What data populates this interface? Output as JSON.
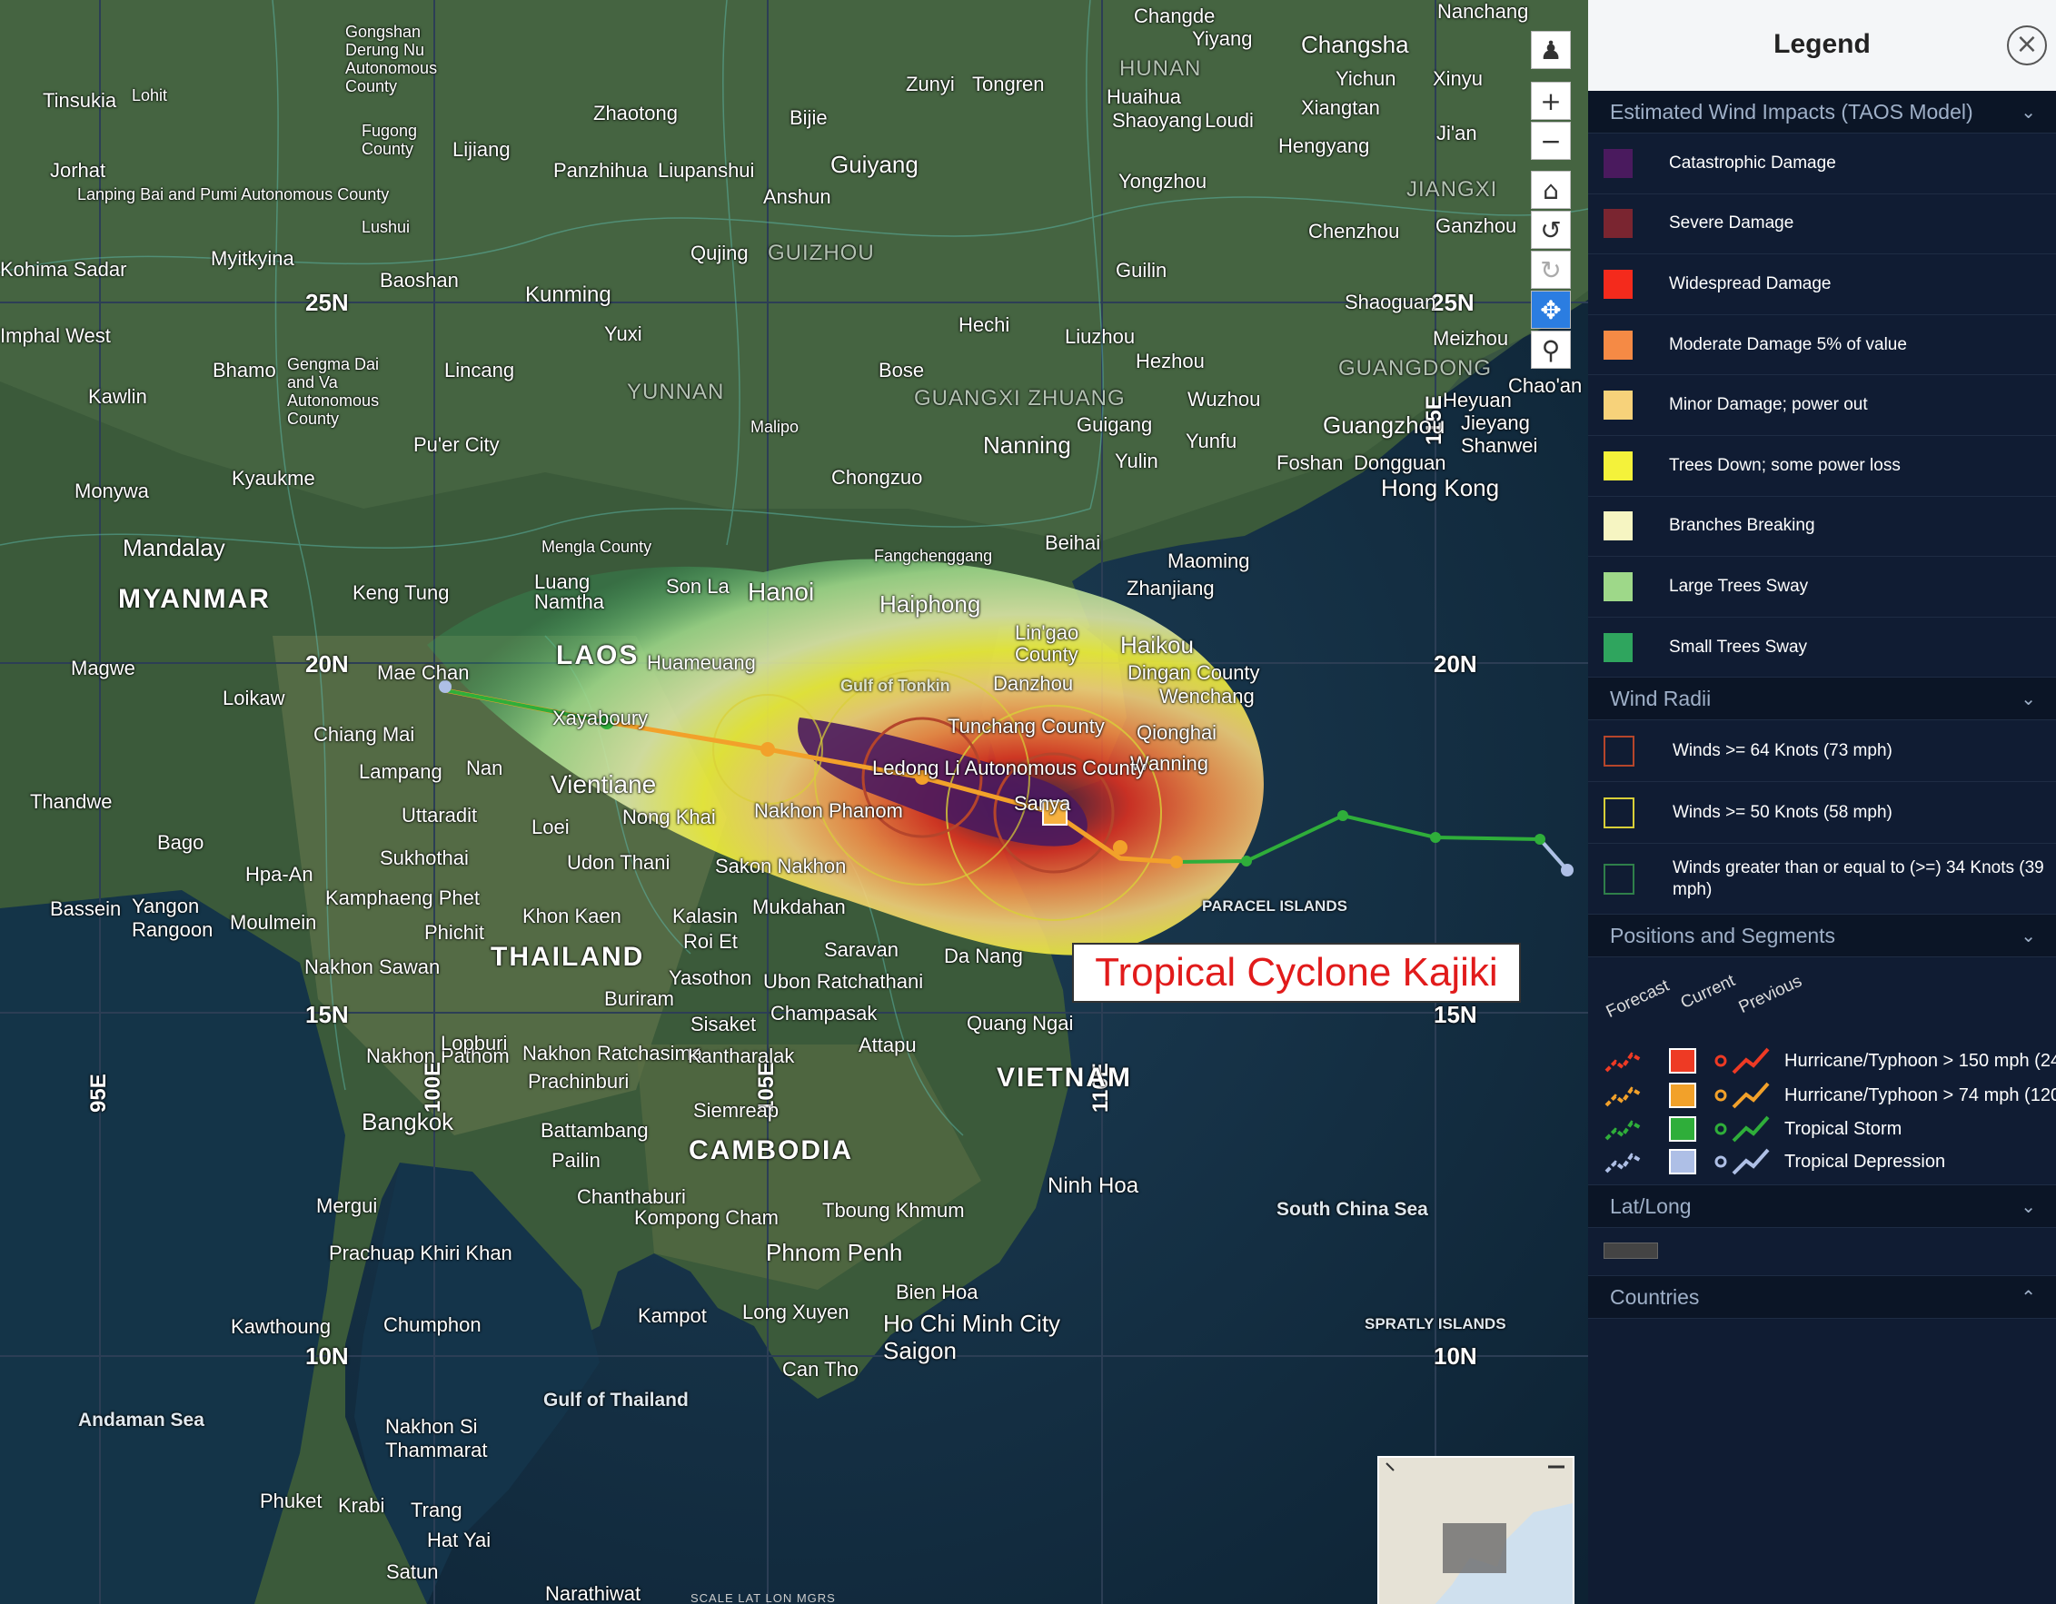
{
  "map": {
    "title_box": "Tropical Cyclone Kajiki",
    "countries": [
      "MYANMAR",
      "LAOS",
      "THAILAND",
      "CAMBODIA",
      "VIETNAM"
    ],
    "provinces": [
      "YUNNAN",
      "GUIZHOU",
      "HUNAN",
      "GUANGXI ZHUANG",
      "GUANGDONG",
      "JIANGXI"
    ],
    "seas": [
      "South China Sea",
      "Gulf of Thailand",
      "Andaman Sea",
      "Gulf of Tonkin",
      "PARACEL ISLANDS",
      "SPRATLY ISLANDS"
    ],
    "grid_labels": {
      "n25": "25N",
      "n20": "20N",
      "n15": "15N",
      "n10": "10N",
      "e95": "95E",
      "e100": "100E",
      "e105": "105E",
      "e110": "110E",
      "e115": "115E"
    },
    "cities": [
      "Tinsukia",
      "Lohit",
      "Jorhat",
      "Kohima Sadar",
      "Imphal West",
      "Myitkyina",
      "Bhamo",
      "Kawlin",
      "Monywa",
      "Mandalay",
      "Kyaukme",
      "Keng Tung",
      "Magwe",
      "Loikaw",
      "Mae Chan",
      "Chiang Mai",
      "Lampang",
      "Nan",
      "Uttaradit",
      "Loei",
      "Sukhothai",
      "Kamphaeng Phet",
      "Phichit",
      "Nakhon Sawan",
      "Bago",
      "Thandwe",
      "Hpa-An",
      "Moulmein",
      "Yangon Rangoon",
      "Bassein",
      "Mergui",
      "Prachuap Khiri Khan",
      "Kawthoung",
      "Chumphon",
      "Nakhon Si Thammarat",
      "Phuket",
      "Krabi",
      "Trang",
      "Hat Yai",
      "Satun",
      "Narathiwat",
      "Bangkok",
      "Nakhon Pathom",
      "Lopburi",
      "Nakhon Ratchasima",
      "Prachinburi",
      "Khon Kaen",
      "Kalasin",
      "Roi Et",
      "Yasothon",
      "Buriram",
      "Sisaket",
      "Udon Thani",
      "Sakon Nakhon",
      "Nakhon Phanom",
      "Mukdahan",
      "Saravan",
      "Ubon Ratchathani",
      "Champasak",
      "Attapu",
      "Kantharalak",
      "Vientiane",
      "Nong Khai",
      "Xayaboury",
      "Huameuang",
      "Luang Namtha",
      "Mengla County",
      "Son La",
      "Hanoi",
      "Haiphong",
      "Fangchenggang",
      "Beihai",
      "Zhanjiang",
      "Maoming",
      "Haikou",
      "Lin'gao County",
      "Danzhou",
      "Dingan County",
      "Wenchang",
      "Tunchang County",
      "Qionghai",
      "Wanning",
      "Ledong Li Autonomous County",
      "Sanya",
      "Da Nang",
      "Quang Ngai",
      "Ninh Hoa",
      "Bien Hoa",
      "Ho Chi Minh City Saigon",
      "Can Tho",
      "Long Xuyen",
      "Kampot",
      "Phnom Penh",
      "Kompong Cham",
      "Tboung Khmum",
      "Siemreap",
      "Battambang",
      "Pailin",
      "Chanthaburi",
      "Kunming",
      "Yuxi",
      "Lincang",
      "Pu'er City",
      "Baoshan",
      "Lushui",
      "Fugong County",
      "Gongshan Derung Nu Autonomous County",
      "Gengma Dai and Va Autonomous County",
      "Lanping Bai and Pumi Autonomous County",
      "Lijiang",
      "Zhaotong",
      "Panzhihua",
      "Liupanshui",
      "Qujing",
      "Guiyang",
      "Anshun",
      "Bijie",
      "Zunyi",
      "Tongren",
      "Changde",
      "Yiyang",
      "Changsha",
      "Nanchang",
      "Huaihua",
      "Shaoyang",
      "Loudi",
      "Yichun",
      "Xinyu",
      "Ji'an",
      "Xiangtan",
      "Hengyang",
      "Yongzhou",
      "Chenzhou",
      "Ganzhou",
      "Guilin",
      "Hechi",
      "Liuzhou",
      "Bose",
      "Nanning",
      "Guigang",
      "Wuzhou",
      "Yulin",
      "Yunfu",
      "Hezhou",
      "Chongzuo",
      "Shaoguan",
      "Meizhou",
      "Heyuan",
      "Chao'an",
      "Guangzhou",
      "Jieyang",
      "Shanwei",
      "Foshan",
      "Dongguan",
      "Hong Kong",
      "Malipo"
    ]
  },
  "toolbar": [
    "pegman-icon",
    "zoom-in-icon",
    "zoom-out-icon",
    "home-icon",
    "rotate-left-icon",
    "rotate-right-icon",
    "pan-icon",
    "magnify-icon"
  ],
  "scalebar": "SCALE     LAT     LON     MGRS",
  "legend": {
    "title": "Legend",
    "sections": {
      "wind_impacts": "Estimated Wind Impacts (TAOS Model)",
      "wind_radii": "Wind Radii",
      "positions": "Positions and Segments",
      "latlong": "Lat/Long",
      "countries": "Countries"
    },
    "impacts": [
      {
        "label": "Catastrophic Damage",
        "color": "#4a1a5e"
      },
      {
        "label": "Severe Damage",
        "color": "#7a2530"
      },
      {
        "label": "Widespread Damage",
        "color": "#f42a1c"
      },
      {
        "label": "Moderate Damage 5% of value",
        "color": "#f58a45"
      },
      {
        "label": "Minor Damage; power out",
        "color": "#f7d27a"
      },
      {
        "label": "Trees Down; some power loss",
        "color": "#f4f23a"
      },
      {
        "label": "Branches Breaking",
        "color": "#f6f5c2"
      },
      {
        "label": "Large Trees Sway",
        "color": "#9ed889"
      },
      {
        "label": "Small Trees Sway",
        "color": "#2fa55e"
      }
    ],
    "radii": [
      {
        "label": "Winds >= 64 Knots (73 mph)",
        "color": "#b5452b"
      },
      {
        "label": "Winds >= 50 Knots (58 mph)",
        "color": "#d8cf38"
      },
      {
        "label": "Winds greater than or equal to (>=) 34 Knots (39 mph)",
        "color": "#2f7f4a"
      }
    ],
    "position_columns": [
      "Forecast",
      "Current",
      "Previous"
    ],
    "positions": [
      {
        "label": "Hurricane/Typhoon > 150 mph (24",
        "color": "#ee3a24"
      },
      {
        "label": "Hurricane/Typhoon > 74 mph (120",
        "color": "#f2a12a"
      },
      {
        "label": "Tropical Storm",
        "color": "#2fae3a"
      },
      {
        "label": "Tropical Depression",
        "color": "#aebfe6"
      }
    ]
  }
}
